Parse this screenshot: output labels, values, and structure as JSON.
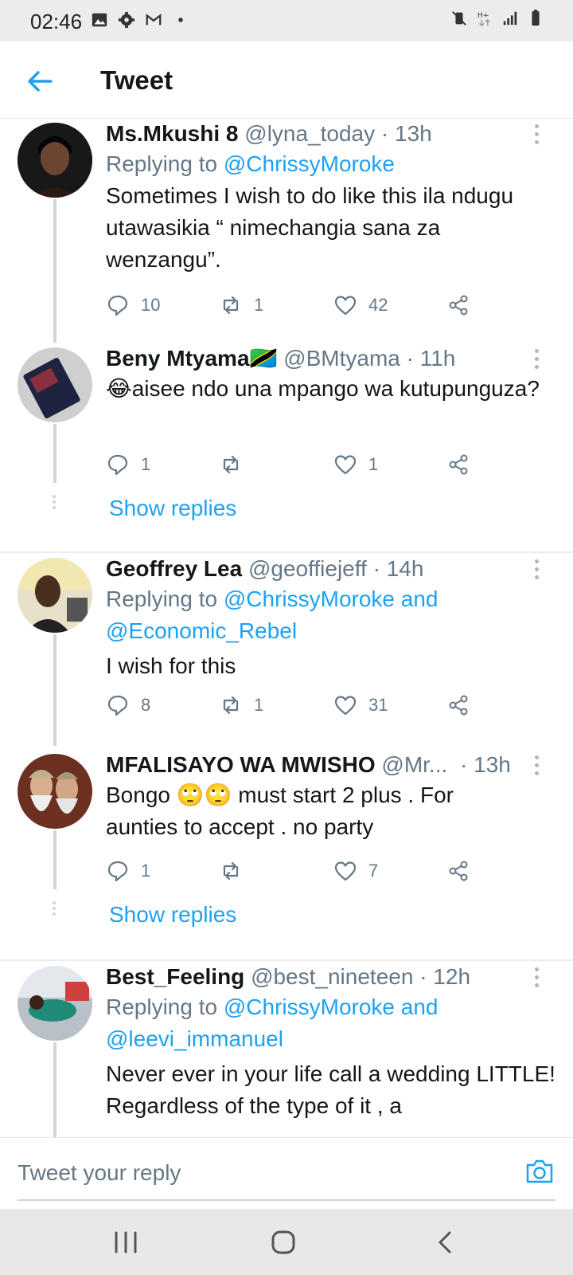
{
  "status_bar": {
    "time": "02:46",
    "icons_left": [
      "image-icon",
      "gear-icon",
      "gmail-icon",
      "dot-icon"
    ],
    "icons_right": [
      "mute-vibrate-icon",
      "h-plus-data-icon",
      "signal-icon",
      "battery-icon"
    ]
  },
  "header": {
    "back_icon": "back-arrow-icon",
    "title": "Tweet"
  },
  "colors": {
    "accent": "#1da1f2",
    "text_primary": "#14171a",
    "text_secondary": "#657786",
    "divider": "#e6ecf0"
  },
  "tweets": [
    {
      "display_name": "Ms.Mkushi 8",
      "handle": "@lyna_today",
      "time": "· 13h",
      "replying_prefix": "Replying to ",
      "replying_to": "@ChrissyMoroke",
      "text": "Sometimes I wish to do like this ila ndugu utawasikia “ nimechangia sana za wenzangu”.",
      "replies": "10",
      "retweets": "1",
      "likes": "42"
    },
    {
      "display_name": "Beny Mtyama",
      "flag": "🇹🇿",
      "handle": "@BMtyama",
      "time": "· 11h",
      "text": "😂aisee ndo una mpango wa kutupunguza?",
      "replies": "1",
      "retweets": "",
      "likes": "1",
      "show_replies": "Show replies"
    },
    {
      "display_name": "Geoffrey Lea",
      "handle": "@geoffiejeff",
      "time": "· 14h",
      "replying_prefix": "Replying to ",
      "replying_to": "@ChrissyMoroke and @Economic_Rebel",
      "text": "I wish for this",
      "replies": "8",
      "retweets": "1",
      "likes": "31"
    },
    {
      "display_name": "MFALISAYO WA MWISHO",
      "handle": "@Mr...",
      "time": "· 13h",
      "text": "Bongo 🙄🙄 must  start  2  plus  .  For aunties  to  accept .  no  party",
      "replies": "1",
      "retweets": "",
      "likes": "7",
      "show_replies": "Show replies"
    },
    {
      "display_name": "Best_Feeling",
      "handle": "@best_nineteen",
      "time": "· 12h",
      "replying_prefix": "Replying to ",
      "replying_to": "@ChrissyMoroke and @leevi_immanuel",
      "text": "Never ever in your life call a wedding LITTLE! Regardless of the type of it , a"
    }
  ],
  "composer": {
    "placeholder": "Tweet your reply",
    "camera_icon": "camera-icon"
  },
  "navbar": {
    "buttons": [
      "recent-apps-icon",
      "home-icon",
      "back-icon"
    ]
  }
}
